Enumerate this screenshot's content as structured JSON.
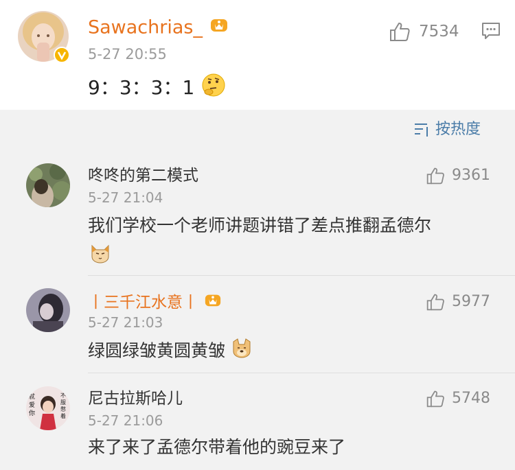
{
  "post": {
    "username": "Sawachrias_",
    "time": "5-27 20:55",
    "text": "9：3：3：1",
    "like_count": "7534",
    "icons": {
      "avatar": "avatar-photo",
      "verified": "verified-badge-icon",
      "vip": "crown-badge-icon",
      "emoji": "thinking-emoji",
      "like": "thumbs-up-icon",
      "reply": "comment-icon"
    }
  },
  "sort": {
    "label": "按热度",
    "icon": "sort-icon"
  },
  "comments": [
    {
      "username": "咚咚的第二模式",
      "time": "5-27 21:04",
      "text": "我们学校一个老师讲题讲错了差点推翻孟德尔",
      "emoji": "cat-emoji",
      "like_count": "9361"
    },
    {
      "username": "丨三千江水意丨",
      "time": "5-27 21:03",
      "text": "绿圆绿皱黄圆黄皱",
      "emoji": "doge-emoji",
      "like_count": "5977"
    },
    {
      "username": "尼古拉斯哈儿",
      "time": "5-27 21:06",
      "text": "来了来了孟德尔带着他的豌豆来了",
      "like_count": "5748",
      "avatar_text": [
        "就",
        "爱",
        "你",
        "不",
        "服",
        "憋",
        "着"
      ]
    }
  ],
  "colors": {
    "vip_name": "#e8731e",
    "link_blue": "#4a7ca8",
    "meta_gray": "#9b9b9b",
    "background": "#f2f2f2"
  }
}
